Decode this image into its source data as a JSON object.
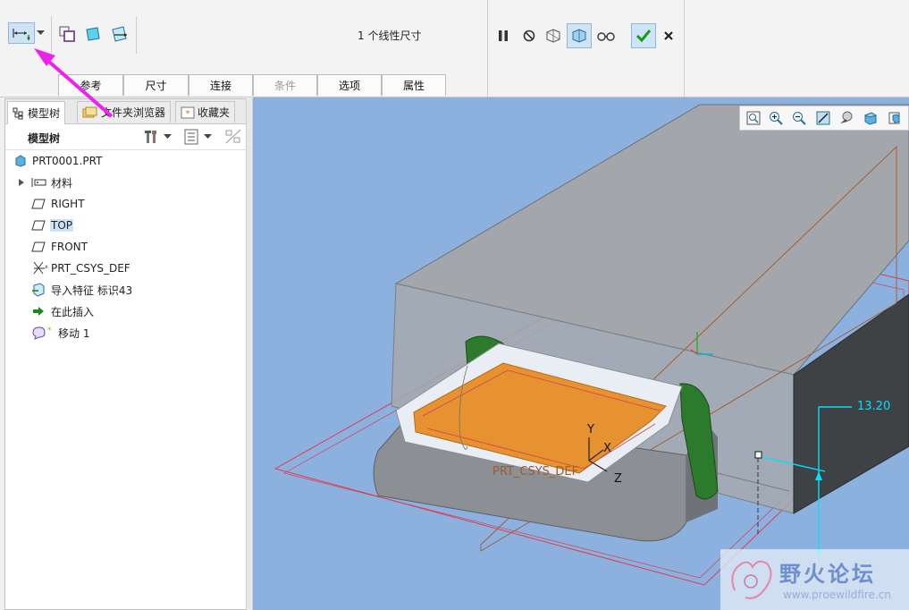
{
  "ribbon": {
    "dimension_count": "1 个线性尺寸",
    "tabs": [
      {
        "label": "参考",
        "enabled": true
      },
      {
        "label": "尺寸",
        "enabled": true
      },
      {
        "label": "连接",
        "enabled": true
      },
      {
        "label": "条件",
        "enabled": false
      },
      {
        "label": "选项",
        "enabled": true
      },
      {
        "label": "属性",
        "enabled": true
      }
    ],
    "left_icons": [
      "move-dimension-icon",
      "dropdown-arrow-icon",
      "placement-icon",
      "surface-icon",
      "plane-move-icon"
    ],
    "right_icons": [
      "pause-icon",
      "stop-icon",
      "preview-icon",
      "feature-preview-icon",
      "glasses-icon",
      "confirm-check-icon",
      "cancel-x-icon"
    ]
  },
  "panel": {
    "tabs": [
      {
        "label": "模型树",
        "icon": "model-tree-icon"
      },
      {
        "label": "文件夹浏览器",
        "icon": "folder-icon"
      },
      {
        "label": "收藏夹",
        "icon": "favorites-icon"
      }
    ],
    "header_title": "模型树",
    "tree": [
      {
        "label": "PRT0001.PRT",
        "icon": "part-icon",
        "indent": 0
      },
      {
        "label": "材料",
        "icon": "material-icon",
        "indent": 1,
        "expandable": true
      },
      {
        "label": "RIGHT",
        "icon": "datum-plane-icon",
        "indent": 1
      },
      {
        "label": "TOP",
        "icon": "datum-plane-icon",
        "indent": 1,
        "selected": true
      },
      {
        "label": "FRONT",
        "icon": "datum-plane-icon",
        "indent": 1
      },
      {
        "label": "PRT_CSYS_DEF",
        "icon": "csys-icon",
        "indent": 1
      },
      {
        "label": "导入特征 标识43",
        "icon": "import-feature-icon",
        "indent": 1
      },
      {
        "label": "在此插入",
        "icon": "insert-here-arrow-icon",
        "indent": 1
      },
      {
        "label": "移动 1",
        "icon": "move-feature-icon",
        "indent": 1
      }
    ]
  },
  "viewport": {
    "view_tools": [
      "zoom-fit-icon",
      "zoom-in-icon",
      "zoom-out-icon",
      "repaint-icon",
      "shading-icon",
      "view-orient-icon",
      "saved-views-icon"
    ],
    "dimension_value": "13.20",
    "csys_label": "PRT_CSYS_DEF",
    "axis_labels": {
      "x": "X",
      "y": "Y",
      "z": "Z"
    }
  },
  "watermark": {
    "title": "野火论坛",
    "url": "www.proewildfire.cn"
  },
  "colors": {
    "viewport_bg": "#8db1df",
    "accent_magenta": "#ee22ee",
    "dimension_cyan": "#00e0ff",
    "confirm_green": "#1a9a1a"
  }
}
